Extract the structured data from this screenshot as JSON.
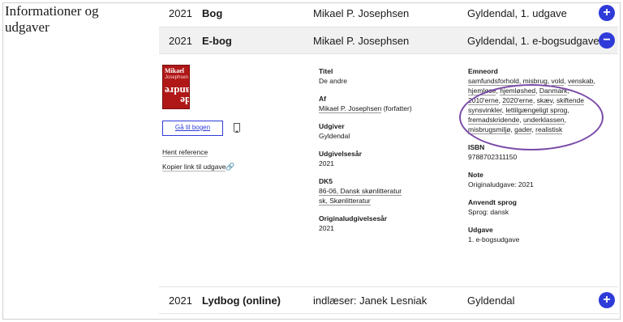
{
  "section": {
    "title": "Informationer og udgaver"
  },
  "editions": [
    {
      "year": "2021",
      "type": "Bog",
      "author": "Mikael P. Josephsen",
      "publisher": "Gyldendal, 1. udgave",
      "toggle": "+"
    },
    {
      "year": "2021",
      "type": "E-bog",
      "author": "Mikael P. Josephsen",
      "publisher": "Gyldendal, 1. e-bogsudgave",
      "toggle": "−"
    },
    {
      "year": "2021",
      "type": "Lydbog (online)",
      "author": "indlæser: Janek Lesniak",
      "publisher": "Gyldendal",
      "toggle": "+"
    }
  ],
  "cover": {
    "line1": "Mikael",
    "line2": "Josephsen",
    "line3": "de andre"
  },
  "actions": {
    "goto_label": "Gå til bogen",
    "reference_label": "Hent reference",
    "copy_link_label": "Kopier link til udgave"
  },
  "details": {
    "title_label": "Titel",
    "title_value": "De andre",
    "by_label": "Af",
    "by_value": "Mikael P. Josephsen",
    "by_role": " (forfatter)",
    "publisher_label": "Udgiver",
    "publisher_value": "Gyldendal",
    "year_label": "Udgivelsesår",
    "year_value": "2021",
    "dk5_label": "DK5",
    "dk5_value1": "86-06, Dansk skønlitteratur",
    "dk5_value2": "sk, Skønlitteratur",
    "orig_year_label": "Originaludgivelsesår",
    "orig_year_value": "2021",
    "subjects_label": "Emneord",
    "subjects": [
      "samfundsforhold",
      "misbrug",
      "vold",
      "venskab",
      "hjemløse",
      "hjemløshed",
      "Danmark",
      "2010'erne",
      "2020'erne",
      "skæv",
      "skiftende synsvinkler",
      "lettilgængeligt sprog",
      "fremadskridende",
      "underklassen",
      "misbrugsmiljø",
      "gader",
      "realistisk"
    ],
    "isbn_label": "ISBN",
    "isbn_value": "9788702311150",
    "note_label": "Note",
    "note_value": "Originaludgave: 2021",
    "lang_label": "Anvendt sprog",
    "lang_value": "Sprog: dansk",
    "edition_label": "Udgave",
    "edition_value": "1. e-bogsudgave"
  },
  "colors": {
    "accent": "#2f3bd8",
    "annotation": "#7a4aa8",
    "row_active": "#f1f1f1"
  }
}
